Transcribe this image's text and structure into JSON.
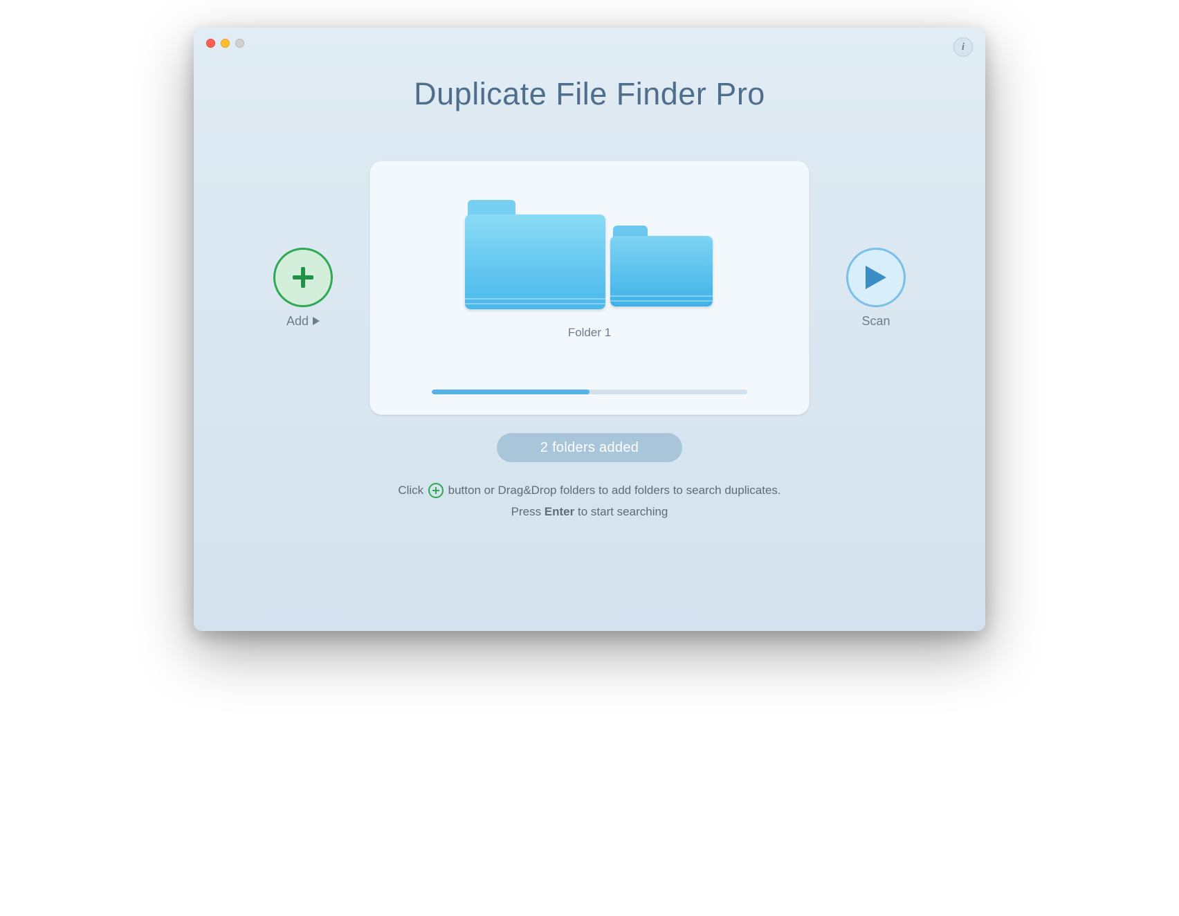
{
  "app": {
    "title": "Duplicate File Finder Pro"
  },
  "buttons": {
    "add_label": "Add",
    "scan_label": "Scan",
    "info_glyph": "i"
  },
  "card": {
    "folder_label": "Folder 1",
    "progress_percent": 50
  },
  "status": {
    "text": "2 folders added"
  },
  "instructions": {
    "line1_pre": "Click ",
    "line1_post": " button or Drag&Drop folders to add folders to search duplicates.",
    "line2_pre": "Press ",
    "line2_bold": "Enter",
    "line2_post": " to start searching"
  },
  "colors": {
    "accent_green": "#30a853",
    "accent_blue": "#4ab8ea"
  }
}
